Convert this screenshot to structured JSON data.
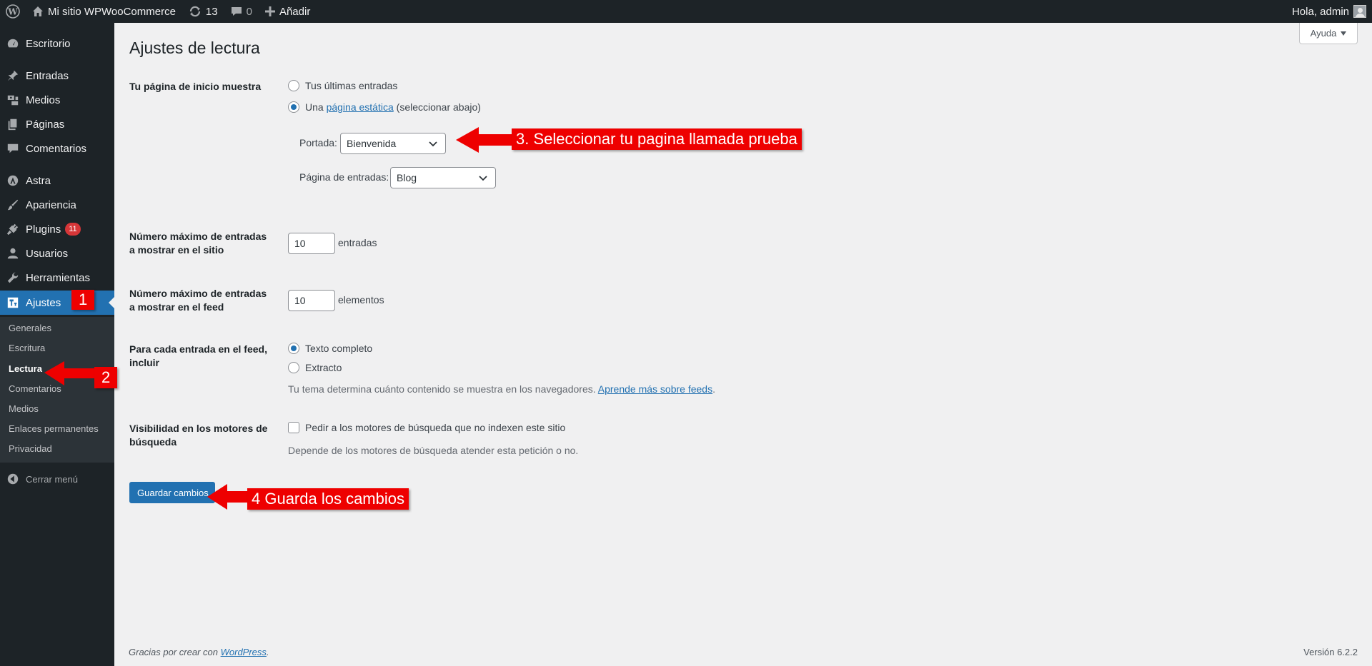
{
  "admin_bar": {
    "site_name": "Mi sitio WPWooCommerce",
    "updates_count": "13",
    "comments_count": "0",
    "new_label": "Añadir",
    "greeting": "Hola, admin"
  },
  "sidebar": {
    "items": [
      {
        "label": "Escritorio",
        "icon": "dashboard-icon"
      },
      {
        "label": "Entradas",
        "icon": "pin-icon"
      },
      {
        "label": "Medios",
        "icon": "media-icon"
      },
      {
        "label": "Páginas",
        "icon": "pages-icon"
      },
      {
        "label": "Comentarios",
        "icon": "comments-icon"
      },
      {
        "label": "Astra",
        "icon": "astra-icon"
      },
      {
        "label": "Apariencia",
        "icon": "brush-icon"
      },
      {
        "label": "Plugins",
        "icon": "plugin-icon",
        "badge": "11"
      },
      {
        "label": "Usuarios",
        "icon": "users-icon"
      },
      {
        "label": "Herramientas",
        "icon": "wrench-icon"
      },
      {
        "label": "Ajustes",
        "icon": "settings-icon"
      }
    ],
    "submenu": [
      "Generales",
      "Escritura",
      "Lectura",
      "Comentarios",
      "Medios",
      "Enlaces permanentes",
      "Privacidad"
    ],
    "collapse_label": "Cerrar menú"
  },
  "help_label": "Ayuda",
  "page_title": "Ajustes de lectura",
  "front_page": {
    "label": "Tu página de inicio muestra",
    "option_latest": "Tus últimas entradas",
    "option_static_prefix": "Una",
    "option_static_link": "página estática",
    "option_static_suffix": "(seleccionar abajo)",
    "portada_label": "Portada:",
    "portada_value": "Bienvenida",
    "posts_page_label": "Página de entradas:",
    "posts_page_value": "Blog"
  },
  "posts_per_page": {
    "label": "Número máximo de entradas a mostrar en el sitio",
    "value": "10",
    "unit": "entradas"
  },
  "posts_per_rss": {
    "label": "Número máximo de entradas a mostrar en el feed",
    "value": "10",
    "unit": "elementos"
  },
  "feed_content": {
    "label": "Para cada entrada en el feed, incluir",
    "option_full": "Texto completo",
    "option_excerpt": "Extracto",
    "desc_prefix": "Tu tema determina cuánto contenido se muestra en los navegadores.",
    "desc_link": "Aprende más sobre feeds",
    "desc_suffix": "."
  },
  "search_visibility": {
    "label": "Visibilidad en los motores de búsqueda",
    "checkbox_label": "Pedir a los motores de búsqueda que no indexen este sitio",
    "desc": "Depende de los motores de búsqueda atender esta petición o no."
  },
  "save_label": "Guardar cambios",
  "footer": {
    "thanks_prefix": "Gracias por crear con",
    "thanks_link": "WordPress",
    "thanks_suffix": ".",
    "version": "Versión 6.2.2"
  },
  "annotations": {
    "a1": "1",
    "a2": "2",
    "a3": "3. Seleccionar tu pagina llamada prueba",
    "a4": "4 Guarda los cambios"
  },
  "colors": {
    "accent": "#2271b1",
    "admin_bar": "#1d2327",
    "annotation": "#ee0000",
    "badge": "#d63638"
  }
}
